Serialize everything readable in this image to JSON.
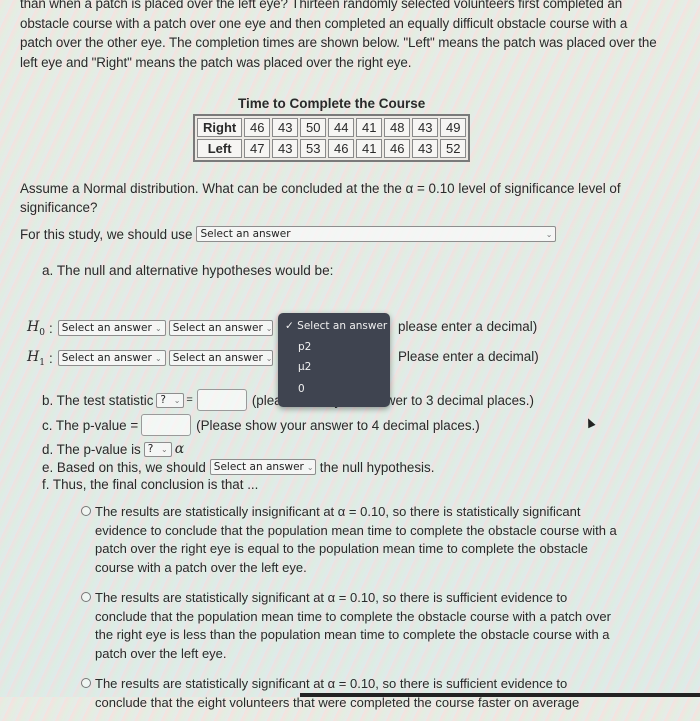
{
  "intro_text": "than when a patch is placed over the left eye? Thirteen randomly selected volunteers first completed an obstacle course with a patch over one eye and then completed an equally difficult obstacle course with a patch over the other eye. The completion times are shown below. \"Left\" means the patch was placed over the left eye and \"Right\" means the patch was placed over the right eye.",
  "table": {
    "title": "Time to Complete the Course",
    "rows": [
      {
        "label": "Right",
        "values": [
          "46",
          "43",
          "50",
          "44",
          "41",
          "48",
          "43",
          "49"
        ]
      },
      {
        "label": "Left",
        "values": [
          "47",
          "43",
          "53",
          "46",
          "41",
          "46",
          "43",
          "52"
        ]
      }
    ]
  },
  "question": "Assume a Normal distribution.  What can be concluded at the the α = 0.10 level of significance level of significance?",
  "study_prefix": "For this study, we should use",
  "select_placeholder": "Select an answer",
  "part_a": "a. The null and alternative hypotheses would be:",
  "h0_label": "H",
  "h0_sub": "0",
  "h1_label": "H",
  "h1_sub": "1",
  "colon": ":",
  "enter_decimal": "please enter a decimal)",
  "enter_decimal_2": "Please enter a decimal)",
  "dropdown_popup": {
    "options": [
      "Select an answer",
      "p2",
      "μ2",
      "0"
    ],
    "checked_index": 0,
    "check_glyph": "✓"
  },
  "part_b_prefix": "b. The test statistic",
  "part_b_equals": "=",
  "part_b_hint": "(please show your answer to 3 decimal places.)",
  "part_c_prefix": "c. The p-value =",
  "part_c_hint": "(Please show your answer to 4 decimal places.)",
  "part_d_prefix": "d. The p-value is",
  "part_d_alpha": "α",
  "question_mark_select": "?",
  "part_e_prefix": "e. Based on this, we should",
  "part_e_suffix": "the null hypothesis.",
  "part_f": "f. Thus, the final conclusion is that ...",
  "conclusions": [
    "The results are statistically insignificant at α = 0.10, so there is statistically significant evidence to conclude that the population mean time to complete the obstacle course with a patch over the right eye is equal to the population mean time to complete the obstacle course with a patch over the left eye.",
    "The results are statistically significant at α = 0.10, so there is sufficient evidence to conclude that the population mean time to complete the obstacle course with a patch over the right eye is less than the population mean time to complete the obstacle course with a patch over the left eye.",
    "The results are statistically significant at α = 0.10, so there is sufficient evidence to conclude that the eight volunteers that were completed the course faster on average"
  ],
  "chevron_glyph": "⌄"
}
